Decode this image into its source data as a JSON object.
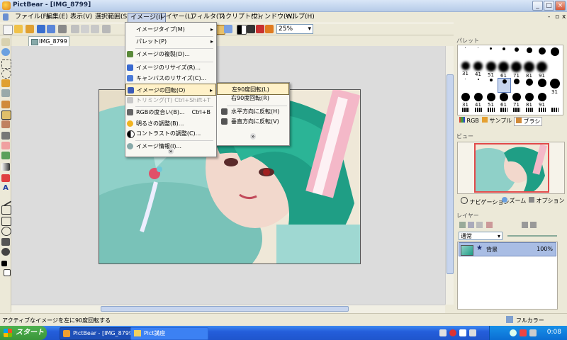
{
  "window": {
    "title": "PictBear - [IMG_8799]"
  },
  "menubar": [
    {
      "label": "ファイル(F)"
    },
    {
      "label": "編集(E)"
    },
    {
      "label": "表示(V)"
    },
    {
      "label": "選択範囲(S)"
    },
    {
      "label": "イメージ(I)"
    },
    {
      "label": "レイヤー(L)"
    },
    {
      "label": "フィルタ(T)"
    },
    {
      "label": "スクリプト(C)"
    },
    {
      "label": "ウィンドウ(W)"
    },
    {
      "label": "ヘルプ(H)"
    }
  ],
  "toolbar": {
    "zoom": "25%"
  },
  "doc_tab": {
    "label": "IMG_8799"
  },
  "image_menu": {
    "items": [
      {
        "label": "イメージタイプ(M)",
        "submenu": true
      },
      {
        "label": "パレット(P)",
        "submenu": true
      },
      {
        "label": "イメージの複製(D)..."
      },
      {
        "label": "イメージのリサイズ(R)..."
      },
      {
        "label": "キャンバスのリサイズ(C)..."
      },
      {
        "label": "イメージの回転(O)",
        "submenu": true,
        "highlighted": true
      },
      {
        "label": "トリミング(T)",
        "shortcut": "Ctrl+Shift+T",
        "disabled": true
      },
      {
        "label": "RGBの度合い(B)...",
        "shortcut": "Ctrl+B"
      },
      {
        "label": "明るさの調整(B)..."
      },
      {
        "label": "コントラストの調整(C)..."
      },
      {
        "label": "イメージ情報(I)..."
      }
    ],
    "more": "»"
  },
  "rotate_submenu": {
    "items": [
      {
        "label": "左90度回転(L)",
        "highlighted": true
      },
      {
        "label": "右90度回転(R)"
      },
      {
        "label": "水平方向に反転(H)"
      },
      {
        "label": "垂直方向に反転(V)"
      }
    ],
    "more": "»"
  },
  "palette_panel": {
    "header": "パレット",
    "brush_sizes": [
      "31",
      "41",
      "51",
      "61",
      "71",
      "81",
      "91",
      "31",
      "41",
      "51",
      "61",
      "71",
      "81",
      "91"
    ],
    "tabs": [
      "RGB",
      "サンプル",
      "ブラシ"
    ]
  },
  "view_panel": {
    "header": "ビュー",
    "tabs": [
      "ナビゲーション",
      "ズーム",
      "オプション"
    ]
  },
  "layer_panel": {
    "header": "レイヤー",
    "blend_mode": "通常",
    "layers": [
      {
        "name": "背景",
        "opacity": "100%"
      }
    ]
  },
  "statusbar": {
    "text": "アクティブなイメージを左に90度回転する",
    "color_mode": "フルカラー"
  },
  "taskbar": {
    "start": "スタート",
    "tasks": [
      {
        "label": "PictBear - [IMG_8799]"
      },
      {
        "label": "Pict講座"
      }
    ],
    "clock": "0:08"
  }
}
